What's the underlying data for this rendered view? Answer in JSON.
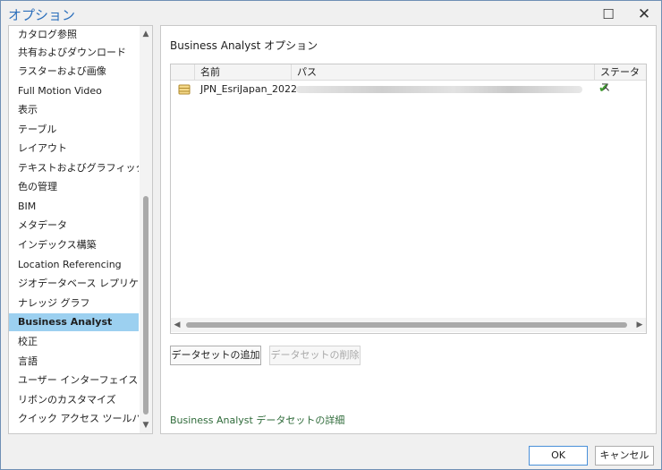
{
  "window": {
    "title": "オプション"
  },
  "sidebar": {
    "items": [
      {
        "label": "カタログ参照",
        "selected": false
      },
      {
        "label": "共有およびダウンロード",
        "selected": false
      },
      {
        "label": "ラスターおよび画像",
        "selected": false
      },
      {
        "label": "Full Motion Video",
        "selected": false
      },
      {
        "label": "表示",
        "selected": false
      },
      {
        "label": "テーブル",
        "selected": false
      },
      {
        "label": "レイアウト",
        "selected": false
      },
      {
        "label": "テキストおよびグラフィックス",
        "selected": false
      },
      {
        "label": "色の管理",
        "selected": false
      },
      {
        "label": "BIM",
        "selected": false
      },
      {
        "label": "メタデータ",
        "selected": false
      },
      {
        "label": "インデックス構築",
        "selected": false
      },
      {
        "label": "Location Referencing",
        "selected": false
      },
      {
        "label": "ジオデータベース レプリケーション",
        "selected": false
      },
      {
        "label": "ナレッジ グラフ",
        "selected": false
      },
      {
        "label": "Business Analyst",
        "selected": true
      },
      {
        "label": "校正",
        "selected": false
      },
      {
        "label": "言語",
        "selected": false
      },
      {
        "label": "ユーザー インターフェイス",
        "selected": false
      },
      {
        "label": "リボンのカスタマイズ",
        "selected": false
      },
      {
        "label": "クイック アクセス ツールバー",
        "selected": false
      }
    ]
  },
  "panel": {
    "title": "Business Analyst オプション",
    "columns": {
      "name": "名前",
      "path": "パス",
      "status": "ステータス"
    },
    "rows": [
      {
        "name": "JPN_EsriJapan_2022",
        "status_icon": "check-icon"
      }
    ],
    "add_button": "データセットの追加",
    "delete_button": "データセットの削除",
    "details_link": "Business Analyst データセットの詳細"
  },
  "footer": {
    "ok": "OK",
    "cancel": "キャンセル"
  },
  "colors": {
    "accent": "#2a6ebb",
    "selection": "#9cd0f0",
    "status_ok": "#3f9b2f",
    "link": "#2f6b3a"
  }
}
